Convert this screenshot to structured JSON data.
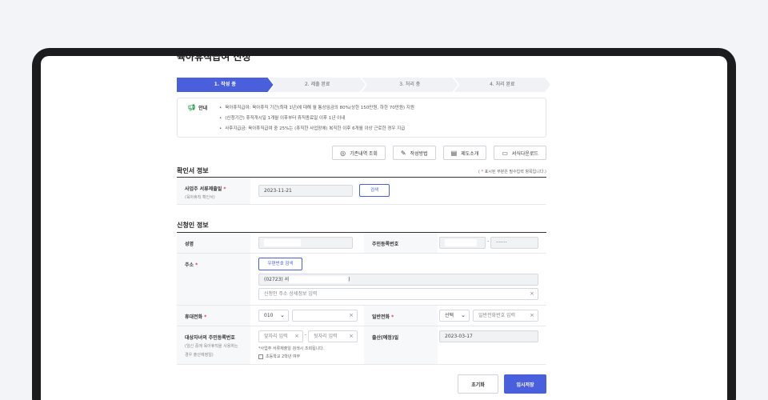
{
  "page": {
    "title": "육아휴직급여 신청"
  },
  "steps": [
    {
      "label": "1. 작성 중",
      "active": true
    },
    {
      "label": "2. 제출 완료",
      "active": false
    },
    {
      "label": "3. 처리 중",
      "active": false
    },
    {
      "label": "4. 처리 완료",
      "active": false
    }
  ],
  "notice": {
    "heading": "안내",
    "items": [
      "육아휴직급여: 육아휴직 기간(최대 1년)에 대해 월 통상임금의 80%(상한 150만원, 하한 70만원) 지원",
      "(신청기간) 휴직개시일 1개월 이후부터 휴직종료일 이후 1년 이내",
      "사후지급금: 육아휴직급여 중 25%는 (휴직한 사업장에) 복직한 이후 6개월 이상 근로한 경우 지급"
    ]
  },
  "toolbar": {
    "history": "기존내역 조회",
    "howto": "작성방법",
    "intro": "제도소개",
    "download": "서식다운로드"
  },
  "confirm_section": {
    "title": "확인서 정보",
    "required_note": "표시된 부분은 필수입력 항목입니다.)",
    "required_note_prefix": "(",
    "date_label": "사업주 서류제출일",
    "date_sublabel": "(육아휴직 확인서)",
    "date_value": "2023-11-21",
    "search_button": "검색"
  },
  "applicant_section": {
    "title": "신청인 정보",
    "name_label": "성명",
    "rrn_label": "주민등록번호",
    "rrn_back": "·······",
    "address_label": "주소",
    "postcode_button": "우편번호 검색",
    "address_line1_prefix": "(02723) 서",
    "address_line1_suffix": ")",
    "address_detail_placeholder": "신청인 주소 상세정보 입력",
    "mobile_label": "휴대전화",
    "mobile_prefix": "010",
    "phone_label": "일반전화",
    "phone_select": "선택",
    "phone_placeholder": "일반전화번호 입력",
    "child_label": "대상자녀의 주민등록번호",
    "child_sublabel": "(임신 중에 육아휴직을 사용하는 경우 출산예정일)",
    "child_front_placeholder": "앞자리 입력",
    "child_back_placeholder": "뒷자리 입력",
    "child_note": "*사업주 서류제출일 검색시 조회됩니다.",
    "child_checkbox": "초등학교 2학년 여부",
    "birth_label": "출산(예정)일",
    "birth_value": "2023-03-17"
  },
  "actions": {
    "reset": "초기화",
    "save": "임시저장"
  },
  "colors": {
    "accent": "#4a5fdc",
    "required": "#e53935"
  }
}
